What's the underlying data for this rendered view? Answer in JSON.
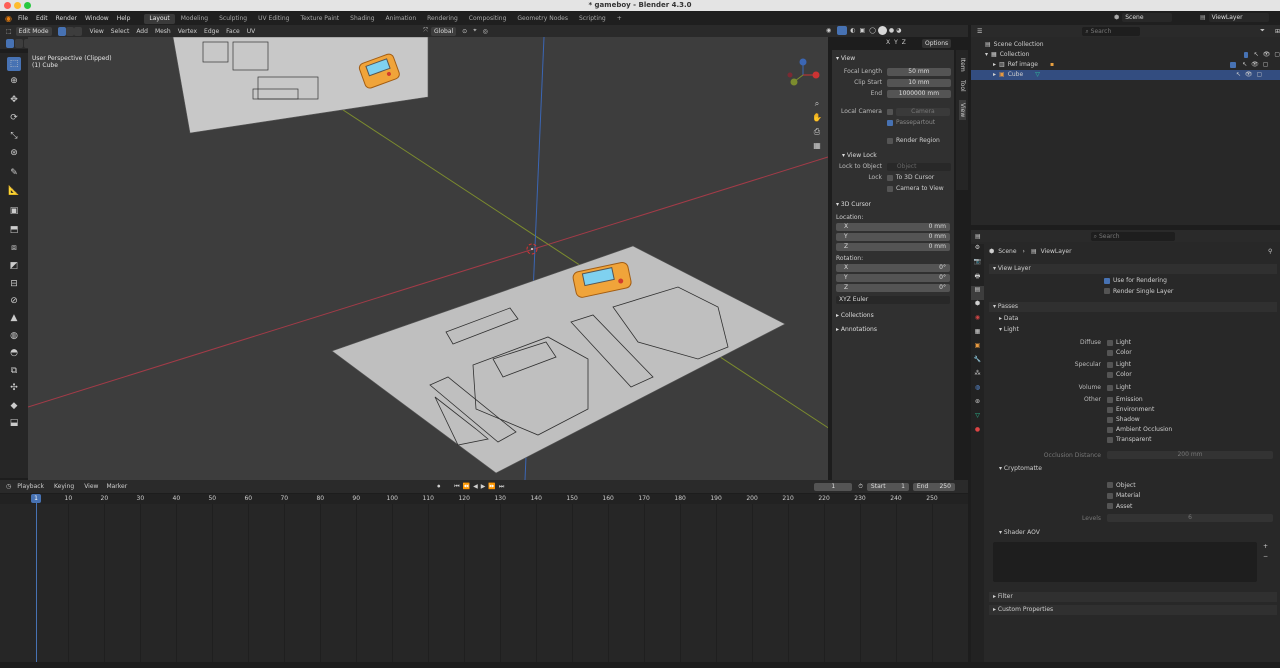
{
  "window": {
    "title": "* gameboy - Blender 4.3.0"
  },
  "menus": [
    "File",
    "Edit",
    "Render",
    "Window",
    "Help"
  ],
  "workspaces": [
    {
      "label": "Layout",
      "active": true
    },
    {
      "label": "Modeling"
    },
    {
      "label": "Sculpting"
    },
    {
      "label": "UV Editing"
    },
    {
      "label": "Texture Paint"
    },
    {
      "label": "Shading"
    },
    {
      "label": "Animation"
    },
    {
      "label": "Rendering"
    },
    {
      "label": "Compositing"
    },
    {
      "label": "Geometry Nodes"
    },
    {
      "label": "Scripting"
    },
    {
      "label": "+"
    }
  ],
  "topright": {
    "scene": "Scene",
    "viewlayer": "ViewLayer"
  },
  "viewport_header": {
    "mode": "Edit Mode",
    "menus": [
      "View",
      "Select",
      "Add",
      "Mesh",
      "Vertex",
      "Edge",
      "Face",
      "UV"
    ],
    "orientation": "Global",
    "options": "Options",
    "axes": [
      "X",
      "Y",
      "Z"
    ]
  },
  "viewport": {
    "overlay_line1": "User Perspective (Clipped)",
    "overlay_line2": "(1) Cube"
  },
  "npanel": {
    "view": {
      "title": "View",
      "focal_length_label": "Focal Length",
      "focal_length": "50 mm",
      "clip_start_label": "Clip Start",
      "clip_start": "10 mm",
      "end_label": "End",
      "end": "1000000 mm",
      "local_camera_label": "Local Camera",
      "camera_placeholder": "Camera",
      "passepartout": "Passepartout",
      "render_region": "Render Region"
    },
    "view_lock": {
      "title": "View Lock",
      "lock_to_object_label": "Lock to Object",
      "object_placeholder": "Object",
      "lock_label": "Lock",
      "to_3d_cursor": "To 3D Cursor",
      "camera_to_view": "Camera to View"
    },
    "cursor": {
      "title": "3D Cursor",
      "location_label": "Location:",
      "x": "0 mm",
      "y": "0 mm",
      "z": "0 mm",
      "rotation_label": "Rotation:",
      "rx": "0°",
      "ry": "0°",
      "rz": "0°",
      "mode": "XYZ Euler"
    },
    "collections": "Collections",
    "annotations": "Annotations",
    "tabs": [
      "Item",
      "Tool",
      "View"
    ]
  },
  "outliner": {
    "search_placeholder": "Search",
    "items": [
      {
        "label": "Scene Collection"
      },
      {
        "label": "Collection"
      },
      {
        "label": "Ref image"
      },
      {
        "label": "Cube",
        "selected": true
      }
    ]
  },
  "properties": {
    "search_placeholder": "Search",
    "breadcrumb": [
      "Scene",
      "ViewLayer"
    ],
    "view_layer": {
      "title": "View Layer",
      "use_for_rendering": "Use for Rendering",
      "render_single_layer": "Render Single Layer"
    },
    "passes": {
      "title": "Passes",
      "data": "Data",
      "light": "Light",
      "diffuse_label": "Diffuse",
      "diffuse": [
        "Light",
        "Color"
      ],
      "specular_label": "Specular",
      "specular": [
        "Light",
        "Color"
      ],
      "volume_label": "Volume",
      "volume": [
        "Light"
      ],
      "other_label": "Other",
      "other": [
        "Emission",
        "Environment",
        "Shadow",
        "Ambient Occlusion",
        "Transparent"
      ],
      "occlusion_distance_label": "Occlusion Distance",
      "occlusion_distance": "200 mm"
    },
    "cryptomatte": {
      "title": "Cryptomatte",
      "items": [
        "Object",
        "Material",
        "Asset"
      ],
      "levels_label": "Levels",
      "levels": "6"
    },
    "shader_aov": "Shader AOV",
    "filter": "Filter",
    "custom_properties": "Custom Properties"
  },
  "timeline": {
    "menus": [
      "Playback",
      "Keying",
      "View",
      "Marker"
    ],
    "current_frame": "1",
    "start_label": "Start",
    "start": "1",
    "end_label": "End",
    "end": "250",
    "ticks": [
      "1",
      "10",
      "20",
      "30",
      "40",
      "50",
      "60",
      "70",
      "80",
      "90",
      "100",
      "110",
      "120",
      "130",
      "140",
      "150",
      "160",
      "170",
      "180",
      "190",
      "200",
      "210",
      "220",
      "230",
      "240",
      "250"
    ]
  }
}
